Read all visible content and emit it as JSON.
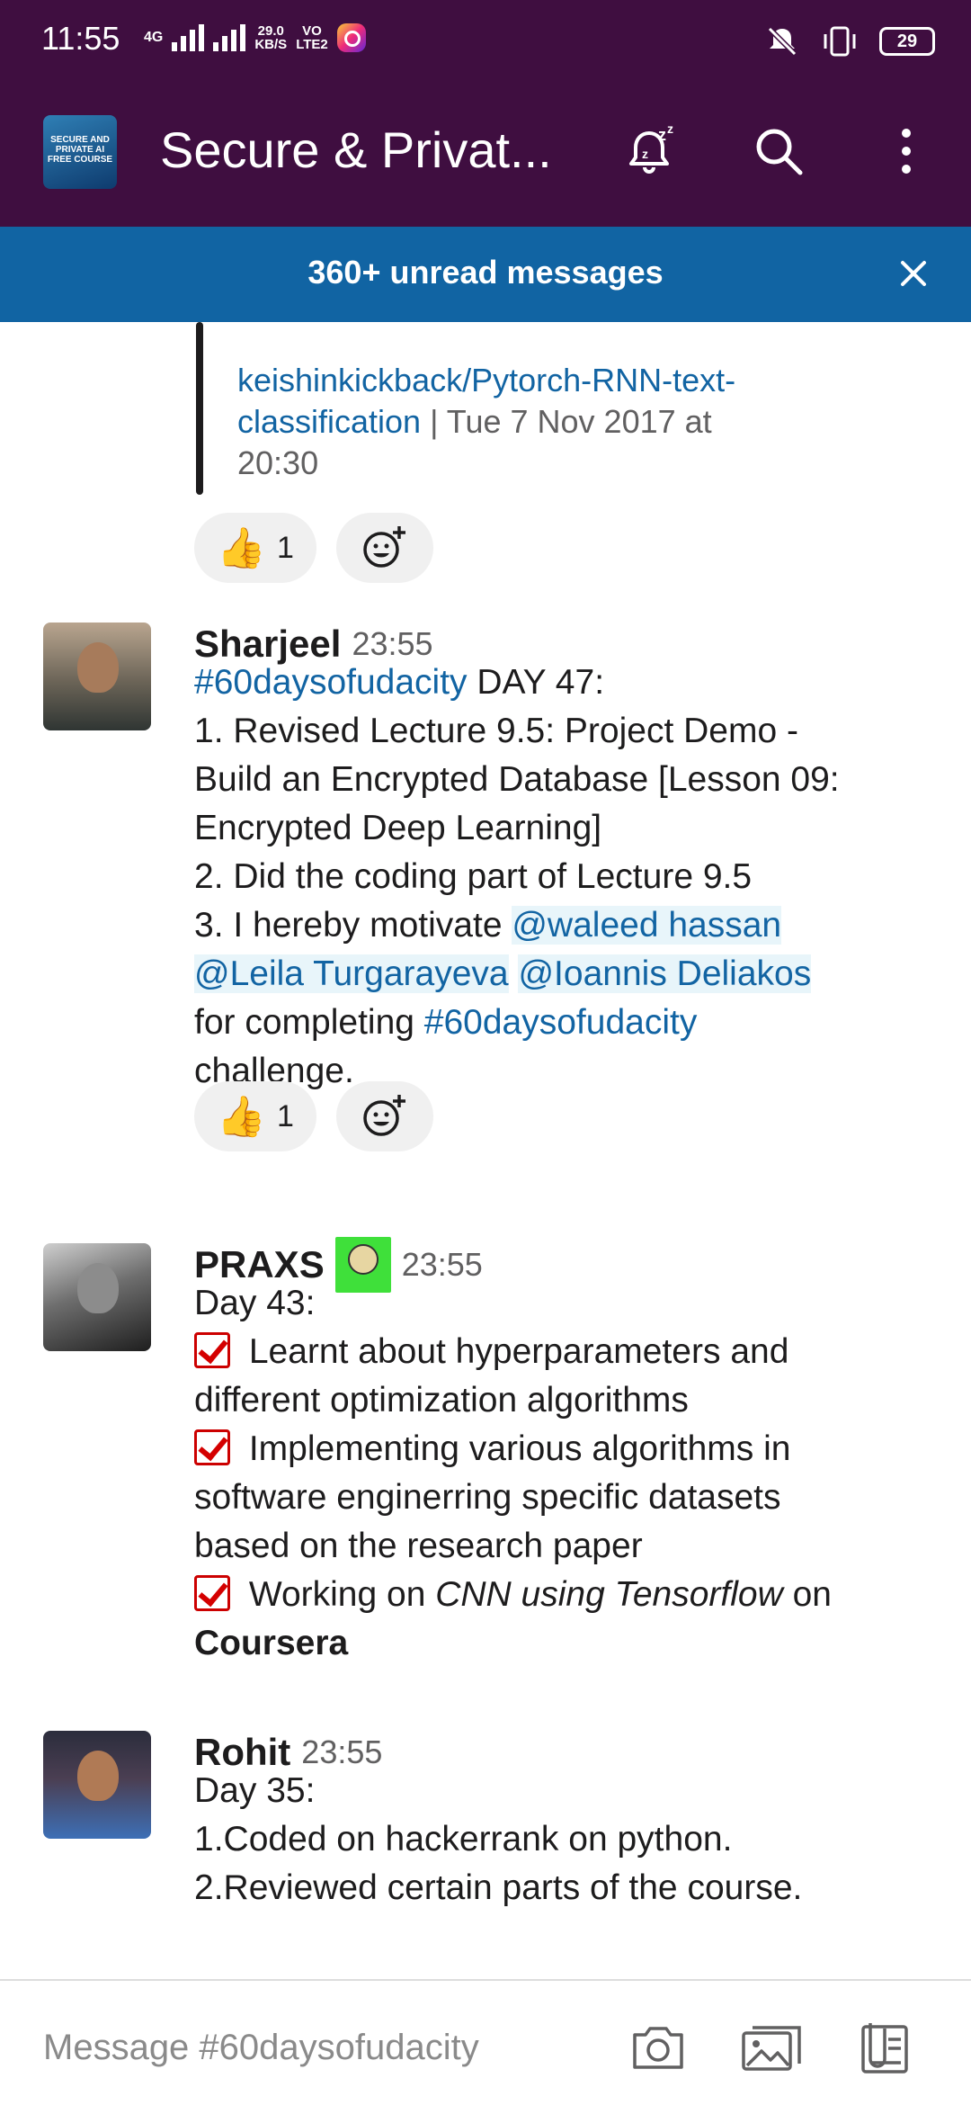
{
  "status_bar": {
    "time": "11:55",
    "network": "4G",
    "speed_value": "29.0",
    "speed_unit": "KB/S",
    "volte_top": "VO",
    "volte_bottom": "LTE2",
    "battery": "29"
  },
  "header": {
    "channel_logo_text": "SECURE AND PRIVATE AI FREE COURSE",
    "title": "Secure & Privat...",
    "colors": {
      "bar": "#3f0e40",
      "banner": "#1164a3",
      "link": "#1264a3"
    }
  },
  "banner": {
    "text": "360+ unread messages"
  },
  "messages": {
    "quoted": {
      "link_text_1": "keishinkickback/Pytorch-RNN-text-",
      "link_text_2": "classification",
      "meta_1": " | Tue 7 Nov 2017 at",
      "meta_2": "20:30",
      "reaction_count": "1"
    },
    "sharjeel": {
      "author": "Sharjeel",
      "time": "23:55",
      "l1_tag": "#60daysofudacity",
      "l1_rest": " DAY 47:",
      "l2": "1. Revised Lecture 9.5: Project Demo -",
      "l3": "Build an Encrypted Database [Lesson 09:",
      "l4": "Encrypted Deep Learning]",
      "l5": "2. Did the coding part of Lecture 9.5",
      "l6_pre": "3. I hereby motivate ",
      "mention_1": "@waleed hassan",
      "mention_2": "@Leila Turgarayeva",
      "mention_3": "@Ioannis Deliakos",
      "l8_pre": " for completing ",
      "l8_tag": "#60daysofudacity",
      "l9": "challenge.",
      "reaction_count": "1"
    },
    "praxs": {
      "author": "PRAXS",
      "time": "23:55",
      "l1": "Day 43:",
      "l2": " Learnt about hyperparameters and",
      "l3": "different optimization algorithms",
      "l4": " Implementing various algorithms in",
      "l5": "software enginerring specific datasets",
      "l6": "based on the research paper",
      "l7_pre": " Working on ",
      "l7_italic": "CNN using Tensorflow",
      "l7_post": " on",
      "l8_bold": "Coursera"
    },
    "rohit": {
      "author": "Rohit",
      "time": "23:55",
      "l1": "Day 35:",
      "l2": "1.Coded on hackerrank on python.",
      "l3": "2.Reviewed certain parts of the course."
    }
  },
  "composer": {
    "placeholder": "Message #60daysofudacity"
  },
  "icons": [
    "channel-logo",
    "snooze-bell-icon",
    "search-icon",
    "more-vertical-icon",
    "close-icon",
    "thumbs-up-emoji",
    "add-reaction-icon",
    "check-mark-emoji",
    "camera-icon",
    "image-icon",
    "files-icon"
  ]
}
